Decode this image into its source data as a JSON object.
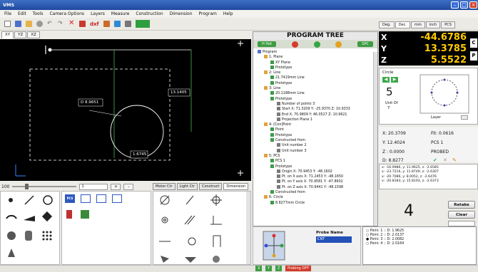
{
  "app": {
    "title": "VMS"
  },
  "menu": [
    "File",
    "Edit",
    "Tools",
    "Camera Options",
    "Layers",
    "Measure",
    "Construction",
    "Dimension",
    "Program",
    "Help"
  ],
  "toolbar": {
    "dxf_label": "dxf"
  },
  "view_tabs": [
    "XY",
    "YZ",
    "XZ"
  ],
  "canvas": {
    "dim1": "D 8.9651",
    "dim2": "13.1405",
    "dim3": "1.6745"
  },
  "zoom": {
    "level": "100",
    "value": "1",
    "plus": "+",
    "minus": "-"
  },
  "control_tabs": [
    "Motor Ctr",
    "Light Ctr",
    "Construct",
    "Dimension"
  ],
  "program_tree": {
    "title": "PROGRAM TREE",
    "home_label": "H Hot",
    "spc_label": "SPC",
    "nodes": [
      {
        "d": 0,
        "t": "Program"
      },
      {
        "d": 1,
        "t": "1: Plane"
      },
      {
        "d": 2,
        "t": "XY Plane"
      },
      {
        "d": 2,
        "t": "Prototype"
      },
      {
        "d": 1,
        "t": "2: Line"
      },
      {
        "d": 2,
        "t": "21.7419mm Line"
      },
      {
        "d": 2,
        "t": "Prototype"
      },
      {
        "d": 1,
        "t": "3: Line"
      },
      {
        "d": 2,
        "t": "20.1188mm Line"
      },
      {
        "d": 2,
        "t": "Prototype"
      },
      {
        "d": 3,
        "t": "Number of points 3"
      },
      {
        "d": 3,
        "t": "Start X: 71.3209 Y: -25.9370 Z: 10.9333"
      },
      {
        "d": 3,
        "t": "End X: 70.9809 Y: 46.0527 Z: 10.9621"
      },
      {
        "d": 3,
        "t": "Projection Plane 1"
      },
      {
        "d": 1,
        "t": "4: [Con]Point"
      },
      {
        "d": 2,
        "t": "Point"
      },
      {
        "d": 2,
        "t": "Prototype"
      },
      {
        "d": 2,
        "t": "Constructed from"
      },
      {
        "d": 3,
        "t": "Unit number 2"
      },
      {
        "d": 3,
        "t": "Unit number 3"
      },
      {
        "d": 1,
        "t": "5: PCS"
      },
      {
        "d": 2,
        "t": "PCS 1"
      },
      {
        "d": 2,
        "t": "Prototype"
      },
      {
        "d": 3,
        "t": "Origin X: 70.9453 Y: -48.1602"
      },
      {
        "d": 3,
        "t": "Pt. on X axis X: 71.2453 Y: -48.1650"
      },
      {
        "d": 3,
        "t": "Pt. on Y axis X: 70.9581 Y: -47.8602"
      },
      {
        "d": 3,
        "t": "Pt. on Z axis X: 70.9441 Y: -48.1598"
      },
      {
        "d": 2,
        "t": "Constructed from"
      },
      {
        "d": 1,
        "t": "6: Circle"
      },
      {
        "d": 2,
        "t": "8.8277mm Circle"
      }
    ]
  },
  "probe": {
    "label": "Probe Name",
    "value": "CNT"
  },
  "probe_points": [
    "Poini: 1 :: D: 1.9625",
    "Poini: 2 :: D: 2.0137",
    "Poini: 3 :: D: 2.0082",
    "Poini: 4 :: D: 2.0164"
  ],
  "units": [
    "Deg.",
    "Dec.",
    "mm",
    "inch",
    "PCS"
  ],
  "dro": {
    "x": "-44.6786",
    "y": "13.3785",
    "z": "5.5522",
    "c_label": "C",
    "p_label": "P"
  },
  "feature": {
    "name": "Circle",
    "count": "5",
    "unit_of_label": "Unit Of",
    "unit_of_value": "7",
    "layer_label": "Layer"
  },
  "info": {
    "x": "X: 20.3709",
    "y": "Y: 12.4024",
    "z": "Z : 0.0000",
    "d": "D: 8.8277",
    "fit": "Fit: 0.0616",
    "pcs": "PCS 1",
    "probed": "PROBED"
  },
  "coords": [
    "x: -16.9986, y: 11.9625, z: -2.6585",
    "x: -23.7216, y: 11.8749, z: -2.6307",
    "x: -20.7086, y: 8.0052, z: -2.6476",
    "x: -20.8183, y: 15.8193, z: -2.6373"
  ],
  "result": {
    "count": "4",
    "retake": "Retake",
    "clear": "Clear"
  },
  "status": {
    "x": "X",
    "y": "Y",
    "z": "Z",
    "probing": "Probing OFF"
  },
  "colors": {
    "titlebar": "#2a56b0",
    "green_button": "#3e9c42",
    "dro_text": "#ffcc00",
    "canvas": "#000000",
    "geometry": "#4caf50"
  }
}
